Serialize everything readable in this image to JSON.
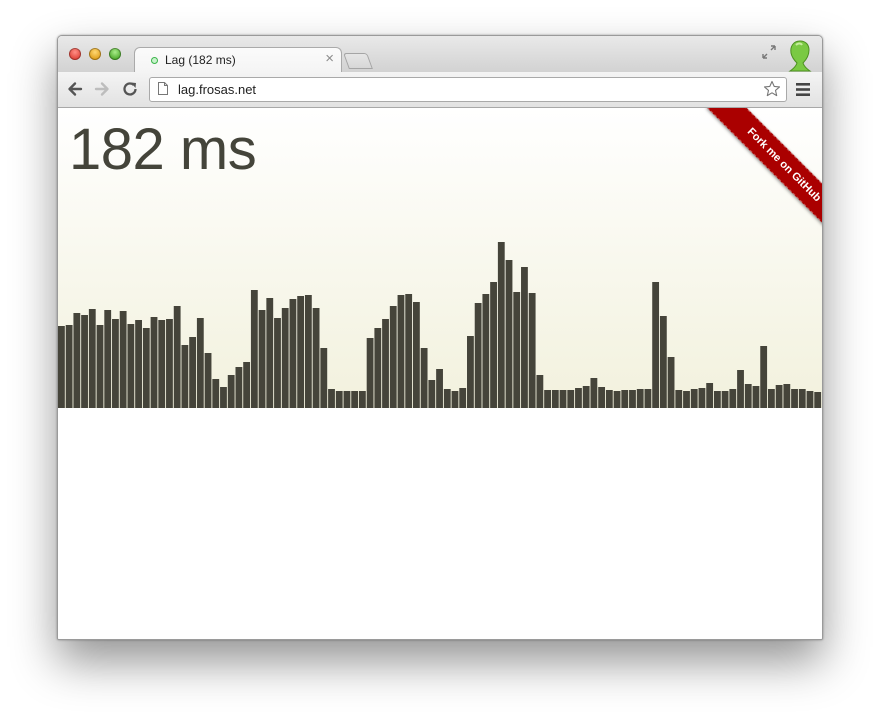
{
  "browser": {
    "tab_title": "Lag (182 ms)",
    "tab_close_glyph": "×",
    "url": "lag.frosas.net",
    "icons": [
      "close-light-icon",
      "minimize-light-icon",
      "zoom-light-icon",
      "loading-dot-icon",
      "tab-close-icon",
      "new-tab-icon",
      "fullscreen-icon",
      "profile-icon",
      "back-arrow-icon",
      "forward-arrow-icon",
      "reload-icon",
      "page-icon",
      "star-icon",
      "menu-icon"
    ]
  },
  "page": {
    "lag_readout": "182 ms",
    "ribbon_text": "Fork me on GitHub",
    "ribbon_color": "#aa0000",
    "bar_color": "#45443a",
    "background_gradient": [
      "#ffffff",
      "#f2f1dd"
    ]
  },
  "chart_data": {
    "type": "bar",
    "title": "",
    "xlabel": "",
    "ylabel": "",
    "ylim": [
      0,
      300
    ],
    "values": [
      82,
      83,
      95,
      93,
      99,
      83,
      98,
      89,
      97,
      84,
      88,
      80,
      91,
      88,
      89,
      102,
      63,
      71,
      90,
      55,
      29,
      21,
      33,
      41,
      46,
      118,
      98,
      110,
      90,
      100,
      109,
      112,
      113,
      100,
      60,
      19,
      17,
      17,
      17,
      17,
      70,
      80,
      89,
      102,
      113,
      114,
      106,
      60,
      28,
      39,
      19,
      17,
      20,
      72,
      105,
      114,
      126,
      166,
      148,
      116,
      141,
      115,
      33,
      18,
      18,
      18,
      18,
      20,
      22,
      30,
      21,
      18,
      17,
      18,
      18,
      19,
      19,
      126,
      92,
      51,
      18,
      17,
      19,
      20,
      25,
      17,
      17,
      19,
      38,
      24,
      22,
      62,
      19,
      23,
      24,
      19,
      19,
      17,
      16
    ]
  }
}
